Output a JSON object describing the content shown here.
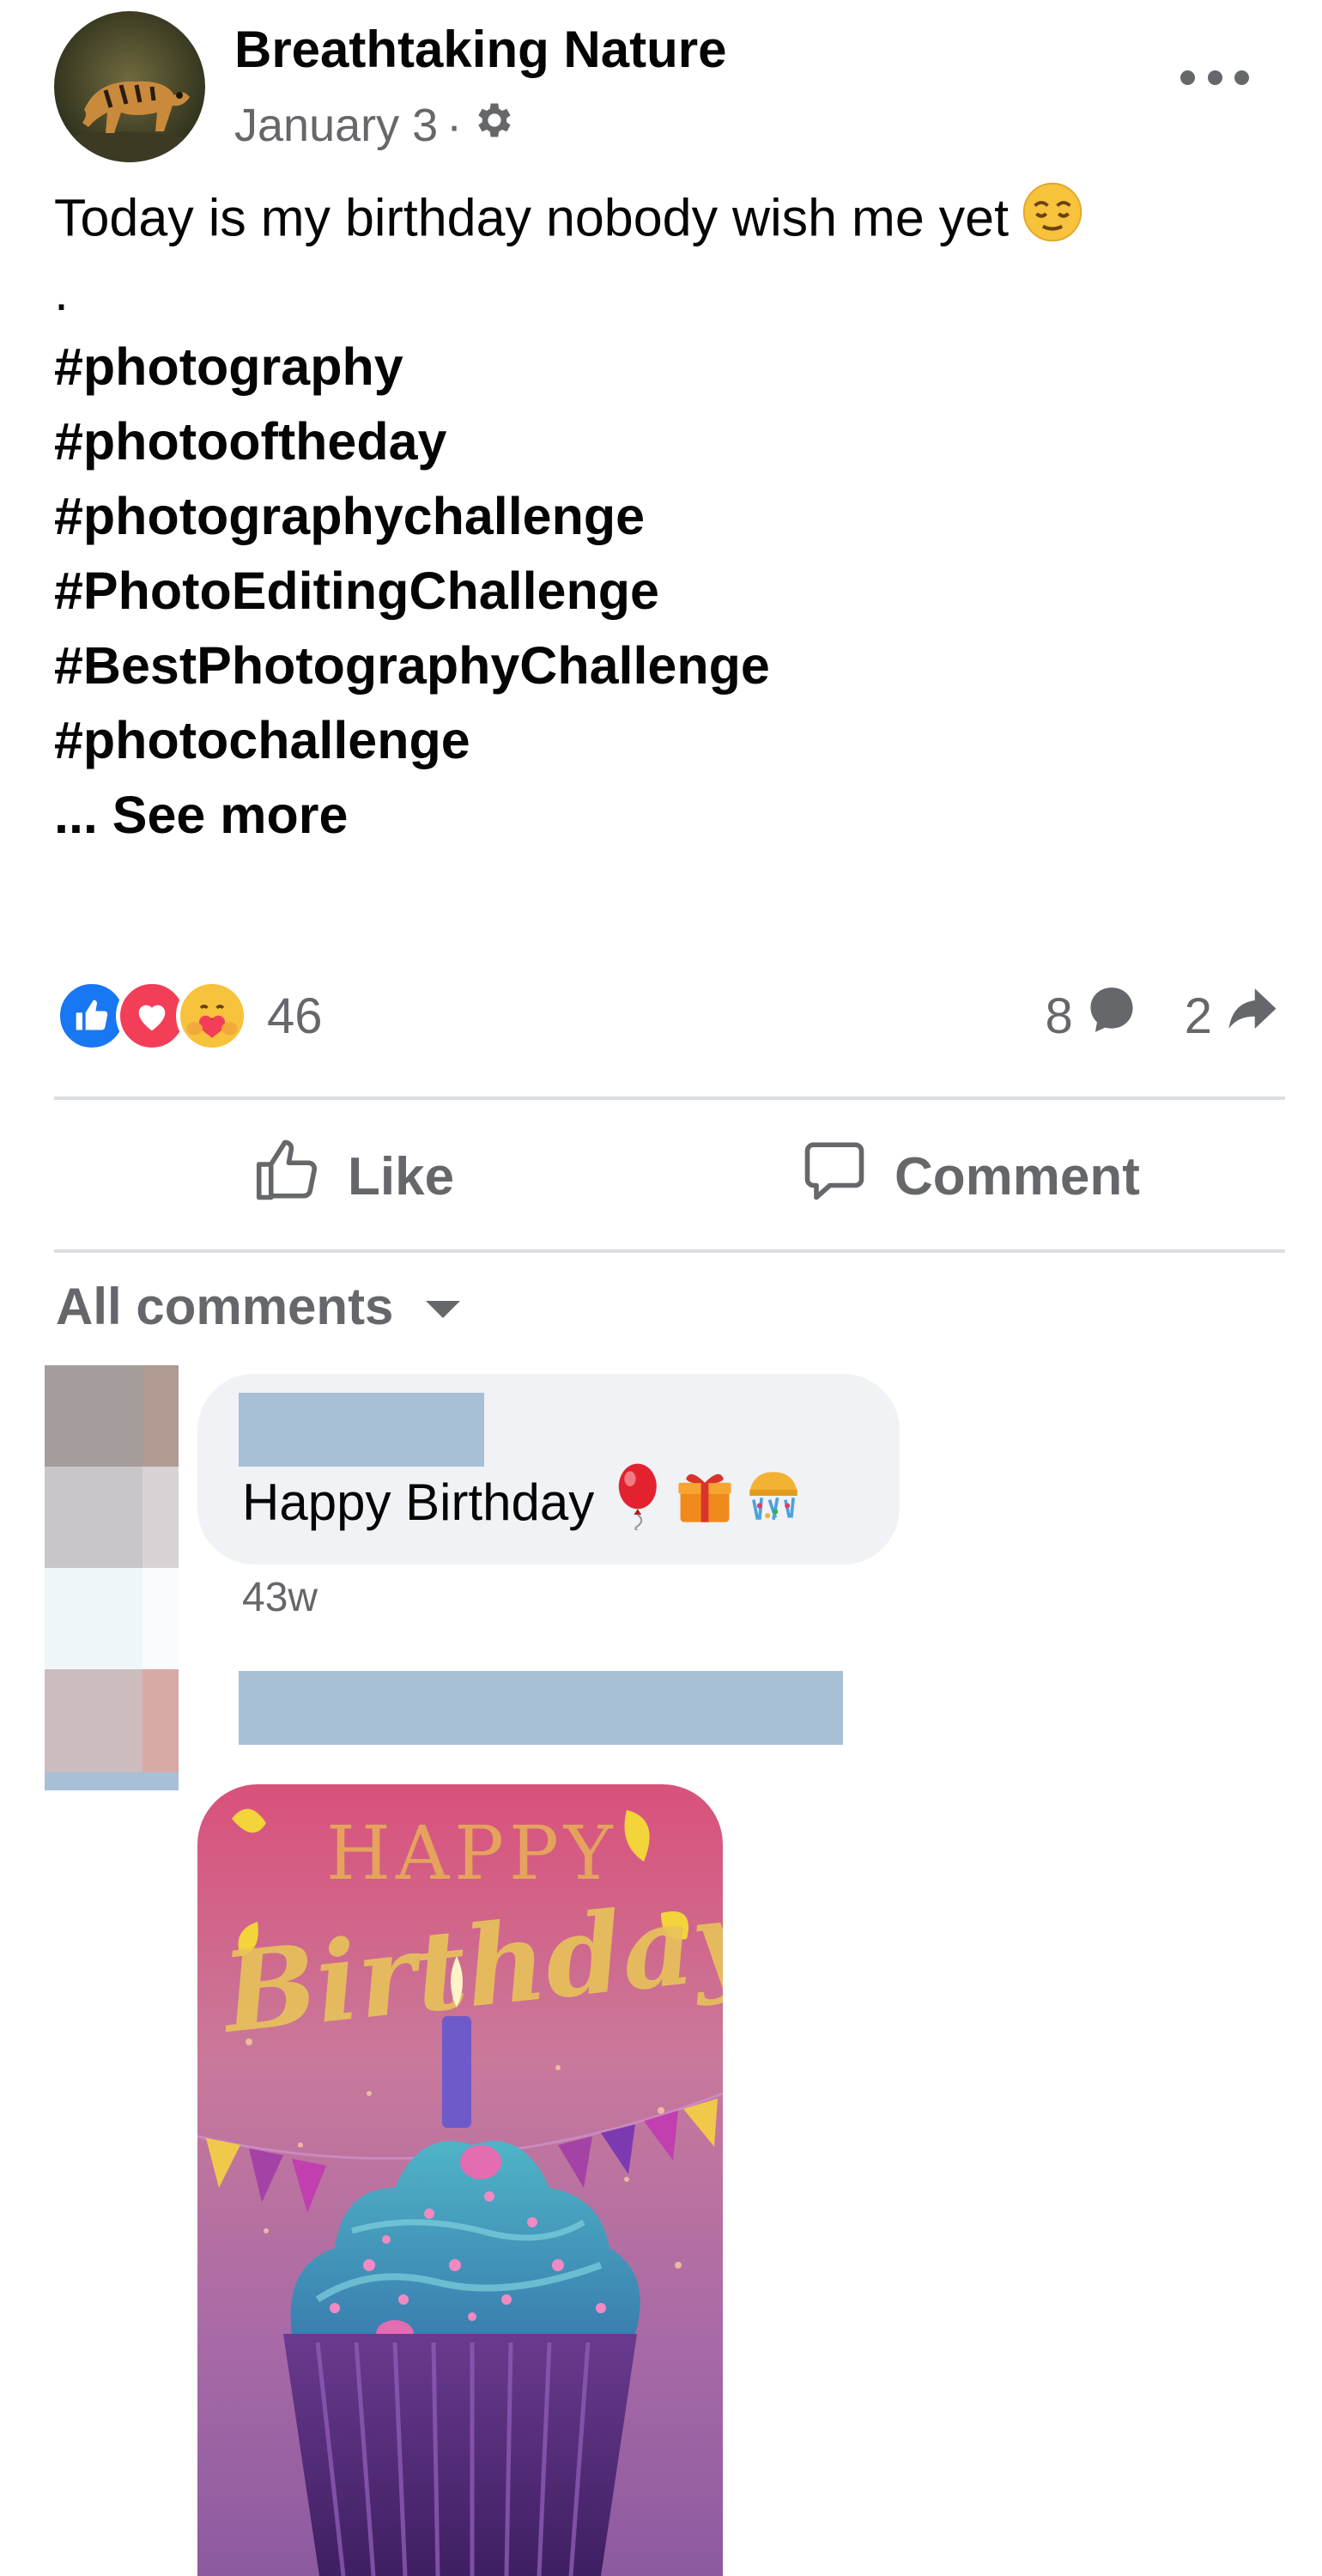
{
  "post": {
    "page_name": "Breathtaking Nature",
    "date": "January 3",
    "separator": "·",
    "privacy_icon": "gear-icon",
    "more_icon": "more-horizontal-icon",
    "text_first_line": "Today is my birthday nobody wish me yet",
    "text_emoji": "relieved-face-emoji",
    "dot_line": ".",
    "hashtags": [
      "#photography",
      "#photooftheday",
      "#photographychallenge",
      "#PhotoEditingChallenge",
      "#BestPhotographyChallenge",
      "#photochallenge"
    ],
    "see_more": "... See more"
  },
  "reactions": {
    "icons": [
      "like-reaction-icon",
      "love-reaction-icon",
      "care-reaction-icon"
    ],
    "count": "46",
    "comments_count": "8",
    "shares_count": "2"
  },
  "actions": {
    "like_label": "Like",
    "comment_label": "Comment"
  },
  "comments_filter": {
    "label": "All comments"
  },
  "comments": [
    {
      "text": "Happy Birthday",
      "emojis": [
        "balloon-emoji",
        "gift-emoji",
        "confetti-emoji"
      ],
      "time": "43w"
    },
    {
      "attachment": "birthday-cupcake-image"
    }
  ],
  "colors": {
    "secondary_text": "#65676b",
    "like_blue": "#1877f2",
    "love_red": "#f33e58",
    "bubble_bg": "#f0f2f5",
    "redaction": "#a7c0d6"
  }
}
